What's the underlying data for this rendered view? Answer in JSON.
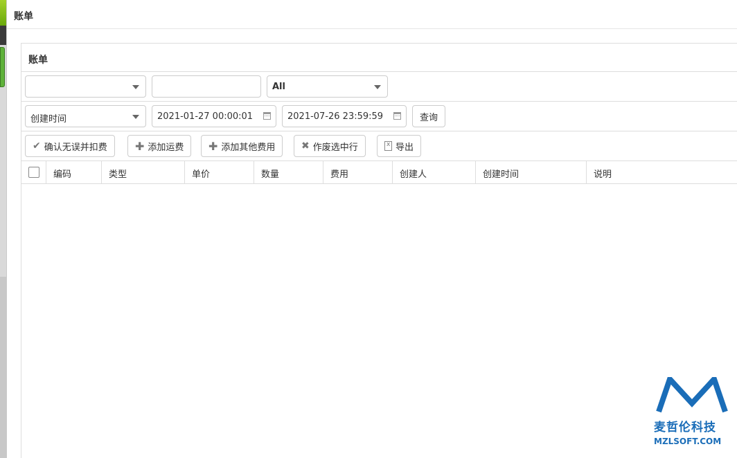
{
  "dialog": {
    "title": "账单"
  },
  "panel": {
    "title": "账单"
  },
  "filters": {
    "select1_value": "",
    "text1_value": "",
    "select2_value": "All",
    "time_field": "创建时间",
    "date_from": "2021-01-27 00:00:01",
    "date_to": "2021-07-26 23:59:59",
    "query_label": "查询"
  },
  "toolbar": {
    "confirm_label": "确认无误并扣费",
    "add_freight_label": "添加运费",
    "add_other_label": "添加其他费用",
    "void_label": "作废选中行",
    "export_label": "导出"
  },
  "table": {
    "columns": [
      "编码",
      "类型",
      "单价",
      "数量",
      "费用",
      "创建人",
      "创建时间",
      "说明"
    ],
    "rows": []
  },
  "watermark": {
    "cn": "麦哲伦科技",
    "en": "MZLSOFT.COM",
    "color": "#1a6db8"
  }
}
